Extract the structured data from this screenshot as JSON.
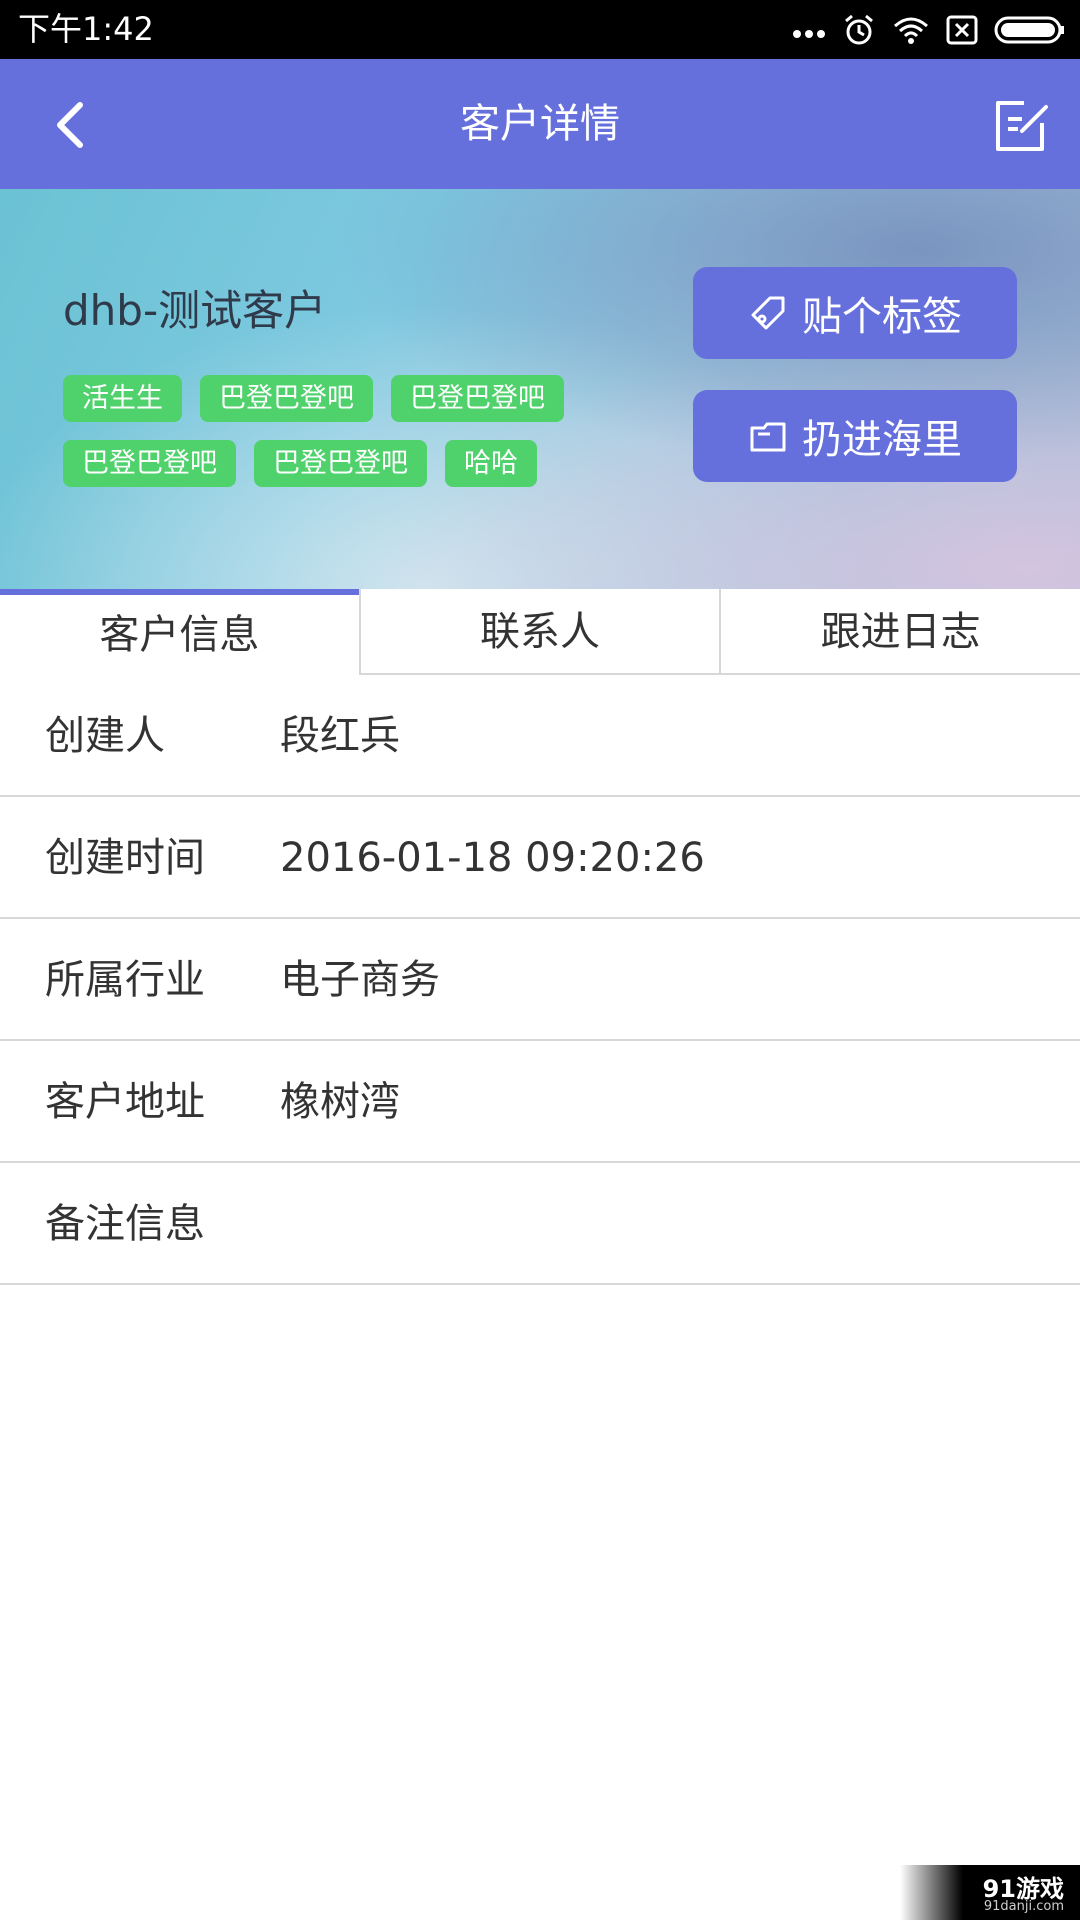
{
  "status_bar": {
    "time": "下午1:42",
    "icons": [
      "more-dots-icon",
      "alarm-icon",
      "wifi-icon",
      "sim-off-icon",
      "battery-icon"
    ]
  },
  "app_bar": {
    "title": "客户详情",
    "back_icon": "chevron-left-icon",
    "edit_icon": "edit-icon"
  },
  "header": {
    "customer_name": "dhb-测试客户",
    "tags": [
      "活生生",
      "巴登巴登吧",
      "巴登巴登吧",
      "巴登巴登吧",
      "巴登巴登吧",
      "哈哈"
    ],
    "tag_button_label": "贴个标签",
    "sea_button_label": "扔进海里"
  },
  "tabs": [
    {
      "label": "客户信息",
      "active": true
    },
    {
      "label": "联系人",
      "active": false
    },
    {
      "label": "跟进日志",
      "active": false
    }
  ],
  "info": [
    {
      "label": "创建人",
      "value": "段红兵"
    },
    {
      "label": "创建时间",
      "value": "2016-01-18 09:20:26"
    },
    {
      "label": "所属行业",
      "value": "电子商务"
    },
    {
      "label": "客户地址",
      "value": "橡树湾"
    },
    {
      "label": "备注信息",
      "value": ""
    }
  ],
  "watermark": {
    "logo": "91游戏",
    "url": "91danji.com"
  },
  "colors": {
    "accent": "#6670dd",
    "tag_green": "#4fd16c",
    "status_bar": "#000000"
  }
}
